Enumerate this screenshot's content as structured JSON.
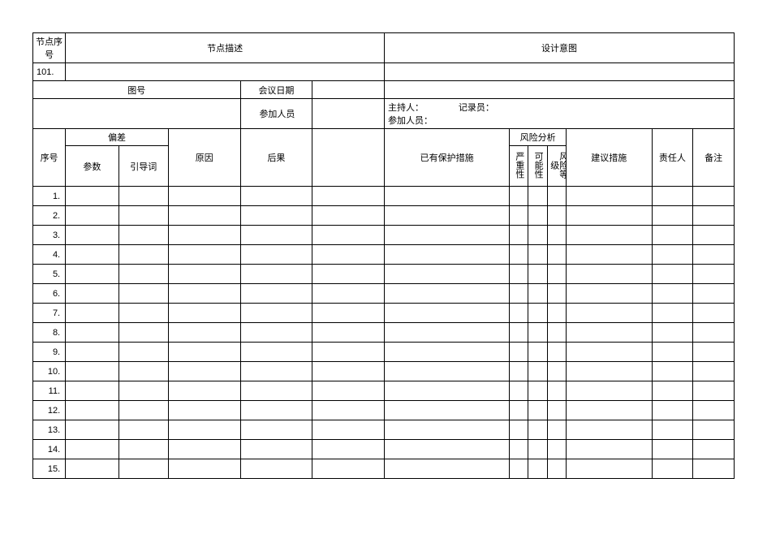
{
  "chart_data": {
    "type": "table",
    "title": "",
    "top_headers": {
      "node_seq_label": "节点序号",
      "node_desc_label": "节点描述",
      "design_intent_label": "设计意图"
    },
    "node_seq_value": "101.",
    "drawing_label": "图号",
    "meeting_date_label": "会议日期",
    "participants_label": "参加人员",
    "host_label": "主持人：",
    "recorder_label": "记录员：",
    "participants_text": "参加人员：",
    "sub_headers": {
      "seq": "序号",
      "deviation": "偏差",
      "param": "参数",
      "guideword": "引导词",
      "cause": "原因",
      "consequence": "后果",
      "safeguards": "已有保护措施",
      "risk_analysis": "风险分析",
      "severity": "严重性",
      "likelihood": "可能性",
      "risk_level": "风险等级",
      "recommendation": "建议措施",
      "responsible": "责任人",
      "remark": "备注"
    },
    "rows": [
      {
        "seq": "1."
      },
      {
        "seq": "2."
      },
      {
        "seq": "3."
      },
      {
        "seq": "4."
      },
      {
        "seq": "5."
      },
      {
        "seq": "6."
      },
      {
        "seq": "7."
      },
      {
        "seq": "8."
      },
      {
        "seq": "9."
      },
      {
        "seq": "10."
      },
      {
        "seq": "11."
      },
      {
        "seq": "12."
      },
      {
        "seq": "13."
      },
      {
        "seq": "14."
      },
      {
        "seq": "15."
      }
    ]
  }
}
